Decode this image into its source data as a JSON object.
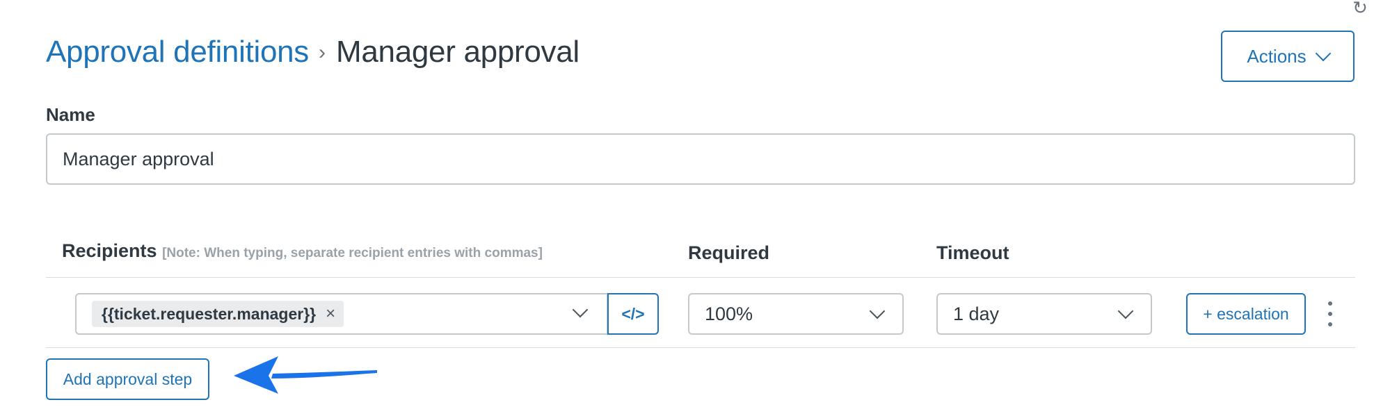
{
  "header": {
    "breadcrumb_parent": "Approval definitions",
    "breadcrumb_separator": "›",
    "breadcrumb_current": "Manager approval",
    "actions_label": "Actions",
    "refresh_icon": "refresh-icon"
  },
  "form": {
    "name_label": "Name",
    "name_value": "Manager approval"
  },
  "steps_table": {
    "headers": {
      "recipients": "Recipients",
      "recipients_note": "[Note: When typing, separate recipient entries with commas]",
      "required": "Required",
      "timeout": "Timeout"
    },
    "rows": [
      {
        "recipient_tag": "{{ticket.requester.manager}}",
        "tag_remove": "×",
        "code_button": "</>",
        "required_value": "100%",
        "timeout_value": "1 day",
        "escalation_label": "+ escalation"
      }
    ]
  },
  "add_step_label": "Add approval step",
  "colors": {
    "accent": "#1f73b7",
    "text": "#2f3941",
    "border": "#c2c8cc",
    "annotation_arrow": "#1a73e8"
  }
}
